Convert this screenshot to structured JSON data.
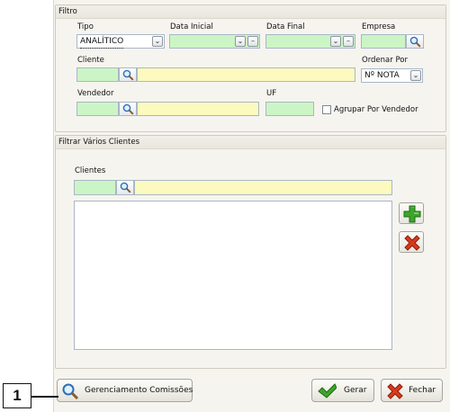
{
  "filtro": {
    "title": "Filtro",
    "tipo_label": "Tipo",
    "tipo_value": "ANALÍTICO",
    "data_inicial_label": "Data Inicial",
    "data_final_label": "Data Final",
    "empresa_label": "Empresa",
    "cliente_label": "Cliente",
    "ordenar_label": "Ordenar Por",
    "ordenar_value": "Nº NOTA",
    "vendedor_label": "Vendedor",
    "uf_label": "UF",
    "agrupar_label": "Agrupar Por Vendedor",
    "agrupar_checked": false
  },
  "clientes": {
    "title": "Filtrar Vários Clientes",
    "clientes_label": "Clientes"
  },
  "footer": {
    "gerenciamento_label": "Gerenciamento Comissões",
    "gerar_label": "Gerar",
    "fechar_label": "Fechar"
  },
  "callout": {
    "number": "1"
  },
  "colors": {
    "field_green": "#ccf5c6",
    "field_yellow": "#fdfabf",
    "panel_bg": "#f6f4ef",
    "add_green": "#3ea52c",
    "remove_red": "#d83a1c"
  },
  "icons": [
    "magnifier-icon",
    "dropdown-arrow-icon",
    "minus-icon",
    "plus-icon",
    "x-icon",
    "checkmark-icon"
  ]
}
